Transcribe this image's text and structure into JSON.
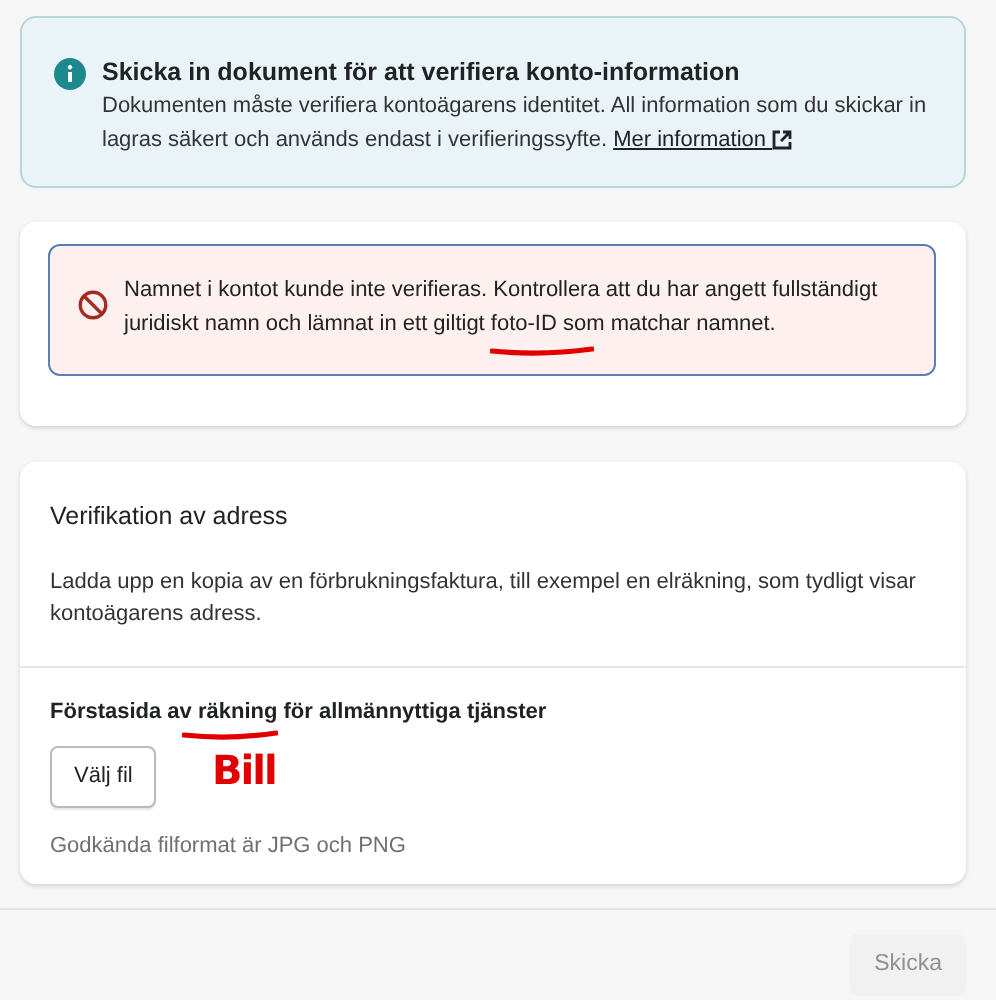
{
  "info_banner": {
    "title": "Skicka in dokument för att verifiera konto-information",
    "text": "Dokumenten måste verifiera kontoägarens identitet. All information som du skickar in lagras säkert och används endast i verifieringssyfte.",
    "link": "Mer information"
  },
  "identity_card": {
    "error": "Namnet i kontot kunde inte verifieras. Kontrollera att du har angett fullständigt juridiskt namn och lämnat in ett giltigt foto-ID som matchar namnet."
  },
  "address_card": {
    "title": "Verifikation av adress",
    "text": "Ladda upp en kopia av en förbrukningsfaktura, till exempel en elräkning, som tydligt visar kontoägarens adress.",
    "field_label": "Förstasida av räkning för allmännyttiga tjänster",
    "button": "Välj fil",
    "hint": "Godkända filformat är JPG och PNG"
  },
  "footer": {
    "button": {
      "label": "Skicka",
      "disabled": true
    }
  },
  "annotations": [
    {
      "kind": "underline"
    },
    {
      "kind": "underline"
    },
    {
      "kind": "handwriting",
      "text": "Bill"
    }
  ]
}
